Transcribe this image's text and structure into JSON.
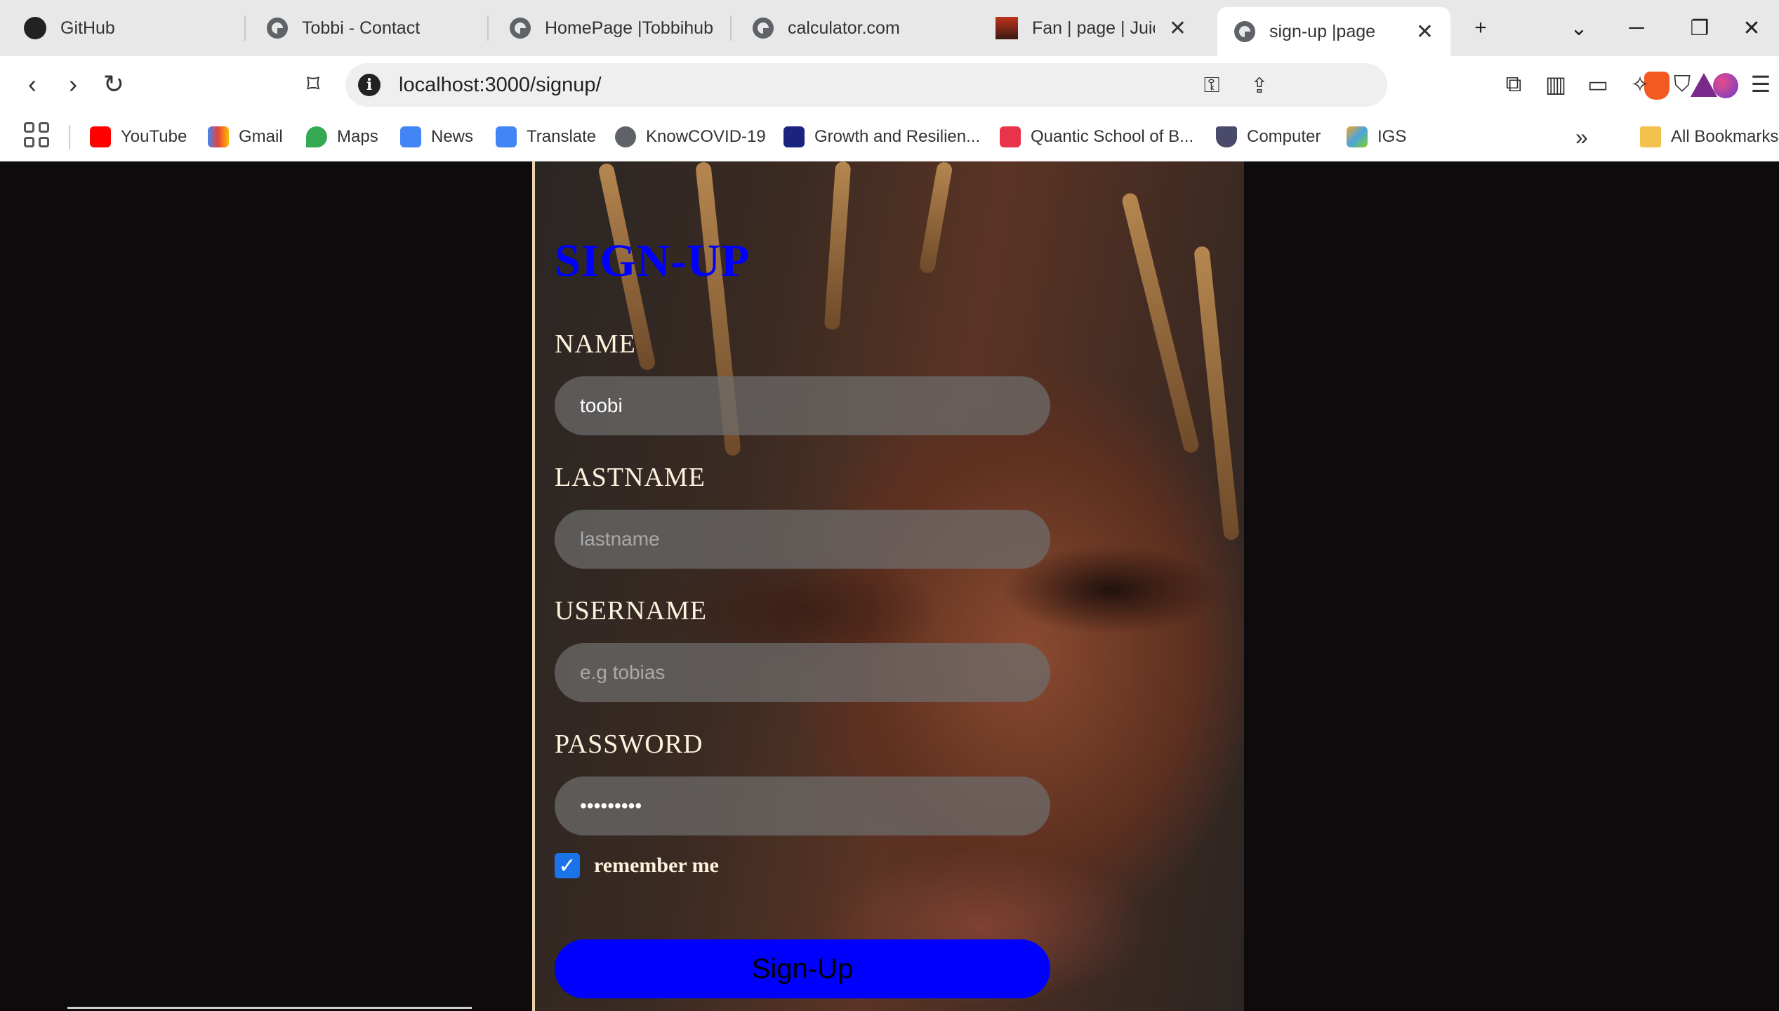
{
  "browser": {
    "tabs": [
      {
        "title": "GitHub",
        "icon": "github-icon"
      },
      {
        "title": "Tobbi - Contact",
        "icon": "globe-icon"
      },
      {
        "title": "HomePage |Tobbihub",
        "icon": "globe-icon"
      },
      {
        "title": "calculator.com",
        "icon": "globe-icon"
      },
      {
        "title": "Fan | page | Juice-W",
        "icon": "site-icon"
      },
      {
        "title": "sign-up |page",
        "icon": "globe-icon",
        "active": true
      }
    ],
    "new_tab_label": "+",
    "address": {
      "url": "localhost:3000/signup/"
    },
    "bookmarks": [
      {
        "label": "YouTube",
        "color": "#ff0000"
      },
      {
        "label": "Gmail",
        "color": "#ea4335"
      },
      {
        "label": "Maps",
        "color": "#34a853"
      },
      {
        "label": "News",
        "color": "#4285f4"
      },
      {
        "label": "Translate",
        "color": "#4285f4"
      },
      {
        "label": "KnowCOVID-19",
        "color": "#5f6368"
      },
      {
        "label": "Growth and Resilien...",
        "color": "#1a237e"
      },
      {
        "label": "Quantic School of B...",
        "color": "#e8334a"
      },
      {
        "label": "Computer",
        "color": "#4a4a6a"
      },
      {
        "label": "IGS",
        "color": "#f5a623"
      }
    ],
    "overflow_label": "»",
    "all_bookmarks_label": "All Bookmarks"
  },
  "signup": {
    "title": "SIGN-UP",
    "fields": [
      {
        "label": "NAME",
        "value": "toobi",
        "placeholder": ""
      },
      {
        "label": "LASTNAME",
        "value": "",
        "placeholder": "lastname"
      },
      {
        "label": "USERNAME",
        "value": "",
        "placeholder": "e.g tobias"
      },
      {
        "label": "PASSWORD",
        "value": "•••••••••",
        "placeholder": ""
      }
    ],
    "remember_label": "remember me",
    "remember_checked": true,
    "submit_label": "Sign-Up"
  },
  "colors": {
    "title": "#0000ff",
    "button": "#0000ff",
    "label": "#fdf3dd",
    "page_bg": "#0d0b0b",
    "panel_border": "#e9d4a9"
  }
}
